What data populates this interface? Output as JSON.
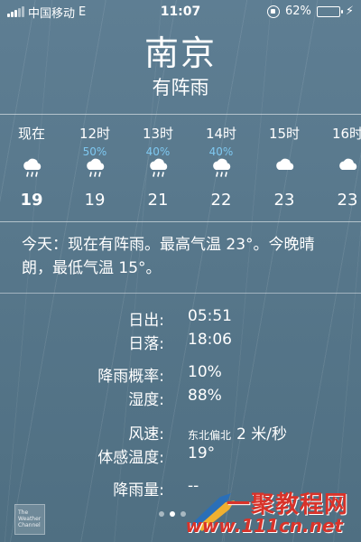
{
  "status_bar": {
    "carrier": "中国移动",
    "network": "E",
    "time": "11:07",
    "battery_percent": "62%",
    "battery_level": 0.62,
    "battery_color": "#66dd44"
  },
  "header": {
    "city": "南京",
    "condition": "有阵雨"
  },
  "hourly": [
    {
      "label": "现在",
      "precip": "",
      "icon": "cloud-rain-icon",
      "temp": "19"
    },
    {
      "label": "12时",
      "precip": "50%",
      "icon": "cloud-rain-icon",
      "temp": "19"
    },
    {
      "label": "13时",
      "precip": "40%",
      "icon": "cloud-rain-icon",
      "temp": "21"
    },
    {
      "label": "14时",
      "precip": "40%",
      "icon": "cloud-rain-icon",
      "temp": "22"
    },
    {
      "label": "15时",
      "precip": "",
      "icon": "cloud-icon",
      "temp": "23"
    },
    {
      "label": "16时",
      "precip": "",
      "icon": "cloud-icon",
      "temp": "23"
    }
  ],
  "summary": "今天：现在有阵雨。最高气温 23°。今晚晴朗，最低气温 15°。",
  "details": {
    "sunrise_label": "日出:",
    "sunrise_value": "05:51",
    "sunset_label": "日落:",
    "sunset_value": "18:06",
    "rain_chance_label": "降雨概率:",
    "rain_chance_value": "10%",
    "humidity_label": "湿度:",
    "humidity_value": "88%",
    "wind_label": "风速:",
    "wind_direction": "东北偏北",
    "wind_value": "2 米/秒",
    "feels_like_label": "体感温度:",
    "feels_like_value": "19°",
    "precip_label": "降雨量:",
    "precip_value": "--"
  },
  "footer": {
    "logo_text": "The Weather Channel",
    "watermark_cn": "一聚教程网",
    "watermark_url": "www.111cn.net",
    "page_count": 3,
    "active_page": 1
  },
  "colors": {
    "background": "#58788c",
    "precip_text": "#7ec8f0",
    "watermark": "#d8332a"
  }
}
